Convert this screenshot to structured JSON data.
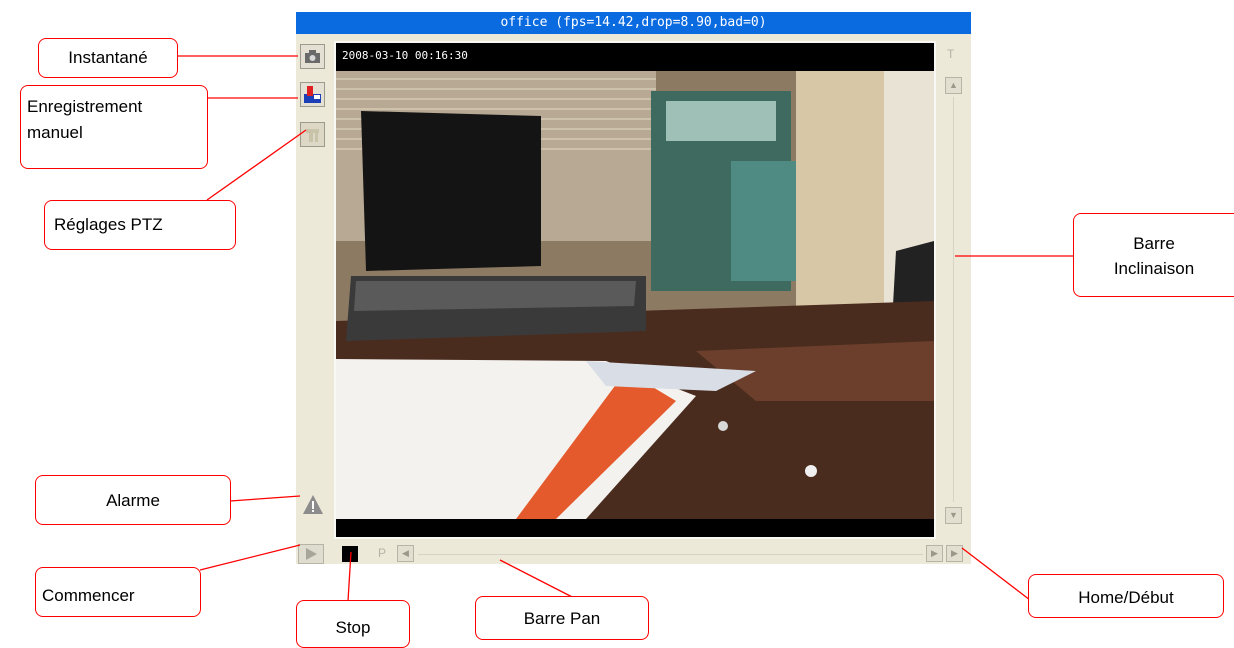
{
  "viewer": {
    "title": "office (fps=14.42,drop=8.90,bad=0)",
    "timestamp": "2008-03-10 00:16:30",
    "tilt_bar_label": "T",
    "pan_bar_label": "P"
  },
  "callouts": {
    "instantane": "Instantané",
    "enregistrement": "Enregistrement\nmanuel",
    "reglages_ptz": "Réglages PTZ",
    "alarme": "Alarme",
    "commencer": "Commencer",
    "stop": "Stop",
    "barre_pan": "Barre Pan",
    "home_debut": "Home/Début",
    "barre_inclinaison": "Barre\nInclinaison"
  },
  "colors": {
    "title_bar": "#0a6ae0",
    "callout_border": "#ff0000",
    "window_bg": "#ece9d8"
  }
}
